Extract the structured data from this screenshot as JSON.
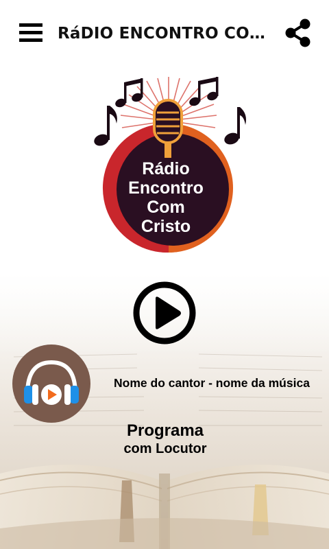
{
  "app_bar": {
    "title": "RáDIO ENCONTRO COM CRISTO",
    "menu_icon": "hamburger-menu-icon",
    "share_icon": "share-icon"
  },
  "logo": {
    "line1": "Rádio",
    "line2": "Encontro",
    "line3": "Com",
    "line4": "Cristo"
  },
  "player": {
    "play_icon": "play-circle-icon",
    "track_text": "Nome do cantor - nome da música",
    "program_name": "Programa",
    "program_host": "com Locutor"
  },
  "colors": {
    "logo_orange": "#e0611f",
    "logo_red": "#c9262c",
    "logo_dark": "#2a0f22",
    "avatar_bg": "#7a5a4c",
    "headphone_blue": "#1e90e8",
    "play_orange": "#f26b1d"
  }
}
